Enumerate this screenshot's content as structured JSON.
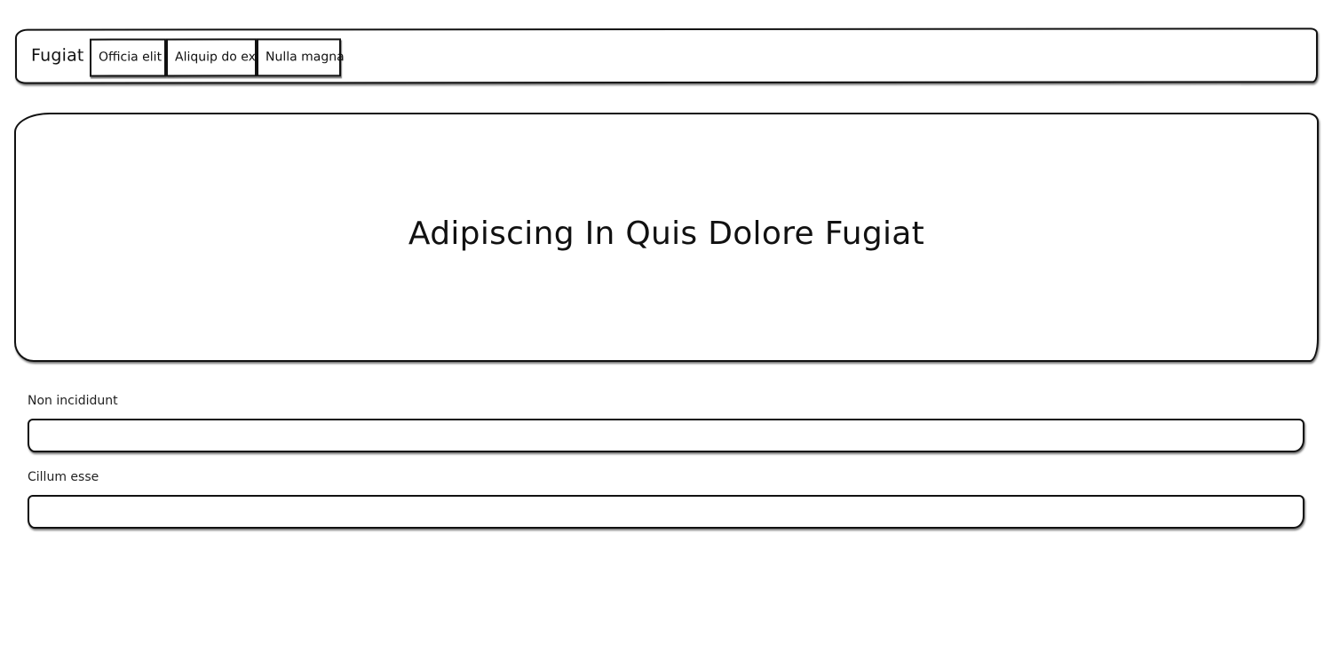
{
  "navbar": {
    "brand": "Fugiat",
    "buttons": [
      {
        "label": "Officia elit"
      },
      {
        "label": "Aliquip do ex"
      },
      {
        "label": "Nulla magna"
      }
    ]
  },
  "hero": {
    "title": "Adipiscing In Quis Dolore Fugiat"
  },
  "form": {
    "fields": [
      {
        "label": "Non incididunt",
        "value": "",
        "placeholder": ""
      },
      {
        "label": "Cillum esse",
        "value": "",
        "placeholder": ""
      }
    ]
  }
}
